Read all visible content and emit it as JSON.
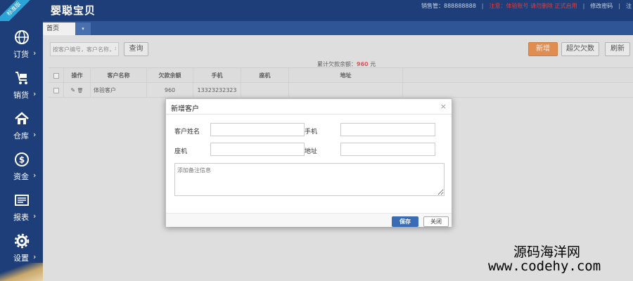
{
  "app": {
    "title": "婴聪宝贝",
    "ribbon": "标准版",
    "top_info": [
      "销售管：888888888",
      "|",
      "注意：体验账号 请勿删除 正式启用",
      "|",
      "修改密码",
      "|",
      "注"
    ]
  },
  "sidebar": {
    "items": [
      {
        "label": "订货",
        "icon": "globe-icon"
      },
      {
        "label": "销货",
        "icon": "cart-icon"
      },
      {
        "label": "仓库",
        "icon": "home-icon"
      },
      {
        "label": "资金",
        "icon": "dollar-icon"
      },
      {
        "label": "报表",
        "icon": "report-icon"
      },
      {
        "label": "设置",
        "icon": "gear-icon"
      }
    ],
    "chevron": "›"
  },
  "tabs": {
    "home": "首页",
    "dropdown": "▾"
  },
  "toolbar": {
    "search_placeholder": "按客户编号，客户名称，手",
    "query": "查询",
    "add": "新增",
    "overdue": "超欠欠数",
    "refresh": "刷新"
  },
  "summary": {
    "label": "累计欠款余额：",
    "amount": "960",
    "unit": "元"
  },
  "table": {
    "headers": [
      "操作",
      "客户名称",
      "欠款余额",
      "手机",
      "座机",
      "地址"
    ],
    "rows": [
      {
        "name": "体验客户",
        "balance": "960",
        "mobile": "13323232323",
        "landline": "",
        "address": ""
      }
    ],
    "edit_icon": "✎",
    "delete_icon": "🗑"
  },
  "modal": {
    "title": "新增客户",
    "close": "×",
    "fields": {
      "name_label": "客户姓名",
      "mobile_label": "手机",
      "landline_label": "座机",
      "address_label": "地址",
      "remark_placeholder": "添加备注信息"
    },
    "save": "保存",
    "cancel": "关闭"
  },
  "watermark": {
    "cn": "源码海洋网",
    "url": "www.codehy.com"
  },
  "colors": {
    "nav": "#1d3e78",
    "accent_orange": "#e87722",
    "save_blue": "#3a6cb5",
    "amount_red": "#e03030"
  }
}
